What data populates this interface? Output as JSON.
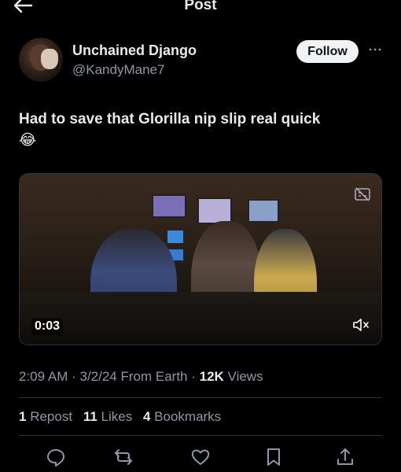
{
  "header": {
    "title": "Post",
    "back_icon": "arrow-left-icon"
  },
  "author": {
    "display_name": "Unchained Django",
    "handle": "@KandyMane7",
    "avatar_icon": "avatar"
  },
  "follow_label": "Follow",
  "tweet": {
    "text": "Had to save that Glorilla nip slip real quick",
    "emoji": "😂"
  },
  "media": {
    "timecode": "0:03",
    "muted": true,
    "mute_icon": "speaker-muted-icon",
    "captions_icon": "captions-off-icon"
  },
  "meta": {
    "time": "2:09 AM",
    "date": "3/2/24",
    "source": "From Earth",
    "views_count": "12K",
    "views_label": "Views"
  },
  "stats": {
    "reposts_count": "1",
    "reposts_label": "Repost",
    "likes_count": "11",
    "likes_label": "Likes",
    "bookmarks_count": "4",
    "bookmarks_label": "Bookmarks"
  },
  "actions": [
    "reply-icon",
    "repost-icon",
    "like-icon",
    "bookmark-icon",
    "share-icon"
  ],
  "colors": {
    "background": "#000000",
    "text_primary": "#e7e9ea",
    "text_secondary": "#8b98a5",
    "divider": "#2f3336",
    "follow_bg": "#eff3f4"
  }
}
